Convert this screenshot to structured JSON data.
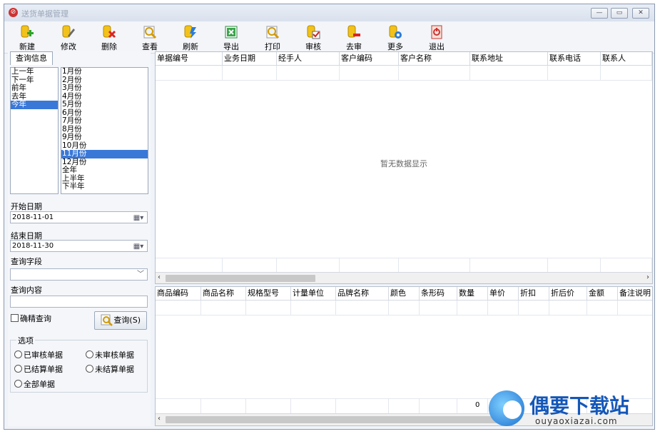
{
  "window": {
    "title": "送货单据管理"
  },
  "toolbar": [
    {
      "key": "new",
      "label": "新建",
      "icon": "new-icon"
    },
    {
      "key": "edit",
      "label": "修改",
      "icon": "edit-icon"
    },
    {
      "key": "delete",
      "label": "删除",
      "icon": "delete-icon"
    },
    {
      "key": "view",
      "label": "查看",
      "icon": "view-icon"
    },
    {
      "key": "refresh",
      "label": "刷新",
      "icon": "refresh-icon"
    },
    {
      "key": "export",
      "label": "导出",
      "icon": "export-icon"
    },
    {
      "key": "print",
      "label": "打印",
      "icon": "print-icon"
    },
    {
      "key": "audit",
      "label": "审核",
      "icon": "audit-icon"
    },
    {
      "key": "unaudit",
      "label": "去审",
      "icon": "unaudit-icon"
    },
    {
      "key": "more",
      "label": "更多",
      "icon": "more-icon"
    },
    {
      "key": "exit",
      "label": "退出",
      "icon": "exit-icon"
    }
  ],
  "query_panel": {
    "tab_label": "查询信息",
    "years": [
      "上一年",
      "下一年",
      "前年",
      "去年",
      "今年"
    ],
    "years_selected": "今年",
    "months": [
      "1月份",
      "2月份",
      "3月份",
      "4月份",
      "5月份",
      "6月份",
      "7月份",
      "8月份",
      "9月份",
      "10月份",
      "11月份",
      "12月份",
      "全年",
      "上半年",
      "下半年"
    ],
    "months_selected": "11月份",
    "start_label": "开始日期",
    "start_value": "2018-11-01",
    "end_label": "结束日期",
    "end_value": "2018-11-30",
    "field_label": "查询字段",
    "field_value": "",
    "content_label": "查询内容",
    "content_value": "",
    "exact_label": "确精查询",
    "query_button": "查询(S)",
    "options_label": "选项",
    "options": [
      "已审核单据",
      "未审核单据",
      "已结算单据",
      "未结算单据",
      "全部单据"
    ]
  },
  "top_grid": {
    "columns": [
      "单据编号",
      "业务日期",
      "经手人",
      "客户编码",
      "客户名称",
      "联系地址",
      "联系电话",
      "联系人"
    ],
    "empty_text": "暂无数据显示"
  },
  "bottom_grid": {
    "columns": [
      "商品编码",
      "商品名称",
      "规格型号",
      "计量单位",
      "品牌名称",
      "颜色",
      "条形码",
      "数量",
      "单价",
      "折扣",
      "折后价",
      "金额",
      "备注说明"
    ],
    "footer_quantity": "0"
  },
  "watermark": {
    "title": "偶要下载站",
    "url": "ouyaoxiazai.com"
  }
}
